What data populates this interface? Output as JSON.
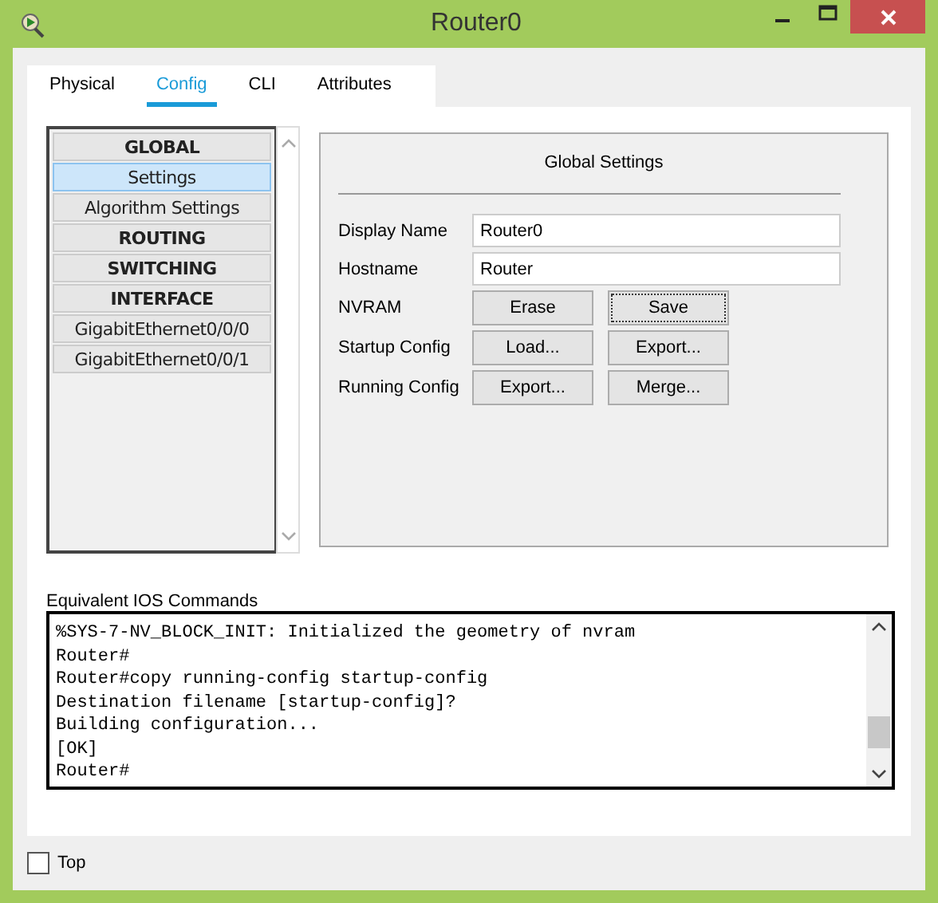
{
  "window": {
    "title": "Router0"
  },
  "tabs": [
    {
      "label": "Physical",
      "selected": false
    },
    {
      "label": "Config",
      "selected": true
    },
    {
      "label": "CLI",
      "selected": false
    },
    {
      "label": "Attributes",
      "selected": false
    }
  ],
  "sidebar": {
    "items": [
      {
        "label": "GLOBAL",
        "kind": "header",
        "selected": false
      },
      {
        "label": "Settings",
        "kind": "item",
        "selected": true
      },
      {
        "label": "Algorithm Settings",
        "kind": "item",
        "selected": false
      },
      {
        "label": "ROUTING",
        "kind": "header",
        "selected": false
      },
      {
        "label": "SWITCHING",
        "kind": "header",
        "selected": false
      },
      {
        "label": "INTERFACE",
        "kind": "header",
        "selected": false
      },
      {
        "label": "GigabitEthernet0/0/0",
        "kind": "item",
        "selected": false
      },
      {
        "label": "GigabitEthernet0/0/1",
        "kind": "item",
        "selected": false
      }
    ]
  },
  "settings": {
    "title": "Global Settings",
    "fields": [
      {
        "label": "Display Name",
        "value": "Router0"
      },
      {
        "label": "Hostname",
        "value": "Router"
      }
    ],
    "button_rows": [
      {
        "label": "NVRAM",
        "buttons": [
          {
            "label": "Erase",
            "focused": false
          },
          {
            "label": "Save",
            "focused": true
          }
        ]
      },
      {
        "label": "Startup Config",
        "buttons": [
          {
            "label": "Load...",
            "focused": false
          },
          {
            "label": "Export...",
            "focused": false
          }
        ]
      },
      {
        "label": "Running Config",
        "buttons": [
          {
            "label": "Export...",
            "focused": false
          },
          {
            "label": "Merge...",
            "focused": false
          }
        ]
      }
    ]
  },
  "console": {
    "label": "Equivalent IOS Commands",
    "lines": [
      "%SYS-7-NV_BLOCK_INIT: Initialized the geometry of nvram",
      "Router#",
      "Router#copy running-config startup-config",
      "Destination filename [startup-config]?",
      "Building configuration...",
      "[OK]",
      "Router#"
    ]
  },
  "top_checkbox": {
    "label": "Top",
    "checked": false
  }
}
